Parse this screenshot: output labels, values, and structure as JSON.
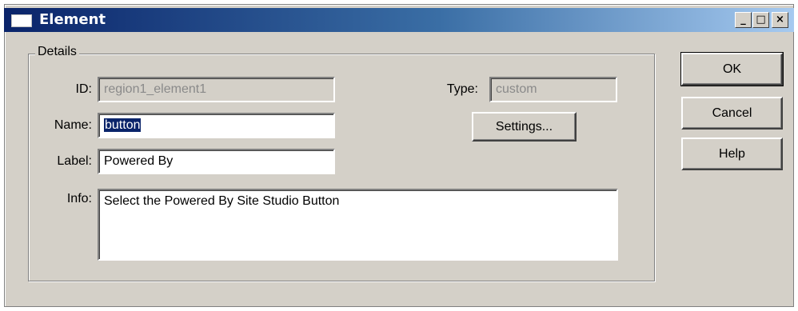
{
  "window": {
    "title": "Element",
    "controls": {
      "minimize": "_",
      "maximize": "□",
      "close": "×"
    }
  },
  "details": {
    "group_label": "Details",
    "id_label": "ID:",
    "id_value": "region1_element1",
    "type_label": "Type:",
    "type_value": "custom",
    "name_label": "Name:",
    "name_value": "button",
    "label_label": "Label:",
    "label_value": "Powered By",
    "info_label": "Info:",
    "info_value": "Select the Powered By Site Studio Button",
    "settings_button": "Settings..."
  },
  "actions": {
    "ok": "OK",
    "cancel": "Cancel",
    "help": "Help"
  }
}
